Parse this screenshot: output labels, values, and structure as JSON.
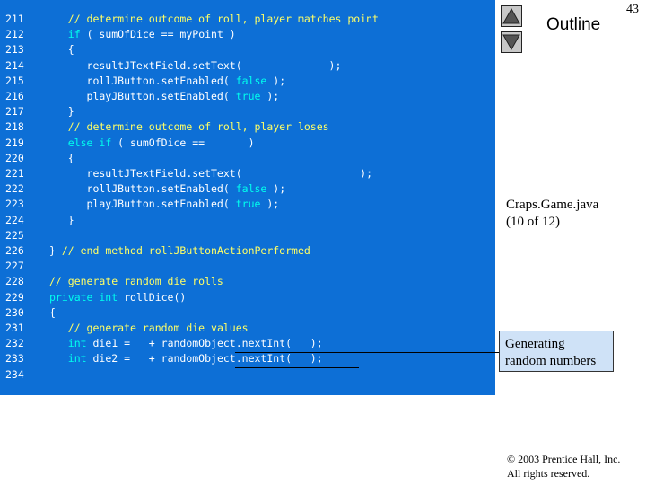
{
  "slide_number": "43",
  "outline_label": "Outline",
  "file_caption": [
    "Craps.Game.java",
    "(10 of 12)"
  ],
  "callout_lines": [
    "Generating",
    "random numbers"
  ],
  "copyright_lines": [
    "© 2003 Prentice Hall, Inc.",
    "All rights reserved."
  ],
  "code_lines": [
    {
      "n": "211",
      "segs": [
        {
          "t": "   ",
          "c": "tx"
        },
        {
          "t": "// determine outcome of roll, player matches point",
          "c": "cm"
        }
      ]
    },
    {
      "n": "212",
      "segs": [
        {
          "t": "   ",
          "c": "tx"
        },
        {
          "t": "if",
          "c": "kw"
        },
        {
          "t": " ( sumOfDice == myPoint )",
          "c": "tx"
        }
      ]
    },
    {
      "n": "213",
      "segs": [
        {
          "t": "   {",
          "c": "tx"
        }
      ]
    },
    {
      "n": "214",
      "segs": [
        {
          "t": "      resultJTextField.setText(              );",
          "c": "tx"
        }
      ]
    },
    {
      "n": "215",
      "segs": [
        {
          "t": "      rollJButton.setEnabled( ",
          "c": "tx"
        },
        {
          "t": "false",
          "c": "kw"
        },
        {
          "t": " );",
          "c": "tx"
        }
      ]
    },
    {
      "n": "216",
      "segs": [
        {
          "t": "      playJButton.setEnabled( ",
          "c": "tx"
        },
        {
          "t": "true",
          "c": "kw"
        },
        {
          "t": " );",
          "c": "tx"
        }
      ]
    },
    {
      "n": "217",
      "segs": [
        {
          "t": "   }",
          "c": "tx"
        }
      ]
    },
    {
      "n": "218",
      "segs": [
        {
          "t": "   ",
          "c": "tx"
        },
        {
          "t": "// determine outcome of roll, player loses",
          "c": "cm"
        }
      ]
    },
    {
      "n": "219",
      "segs": [
        {
          "t": "   ",
          "c": "tx"
        },
        {
          "t": "else if",
          "c": "kw"
        },
        {
          "t": " ( sumOfDice ==       )",
          "c": "tx"
        }
      ]
    },
    {
      "n": "220",
      "segs": [
        {
          "t": "   {",
          "c": "tx"
        }
      ]
    },
    {
      "n": "221",
      "segs": [
        {
          "t": "      resultJTextField.setText(                   );",
          "c": "tx"
        }
      ]
    },
    {
      "n": "222",
      "segs": [
        {
          "t": "      rollJButton.setEnabled( ",
          "c": "tx"
        },
        {
          "t": "false",
          "c": "kw"
        },
        {
          "t": " );",
          "c": "tx"
        }
      ]
    },
    {
      "n": "223",
      "segs": [
        {
          "t": "      playJButton.setEnabled( ",
          "c": "tx"
        },
        {
          "t": "true",
          "c": "kw"
        },
        {
          "t": " );",
          "c": "tx"
        }
      ]
    },
    {
      "n": "224",
      "segs": [
        {
          "t": "   }",
          "c": "tx"
        }
      ]
    },
    {
      "n": "225",
      "segs": []
    },
    {
      "n": "226",
      "segs": [
        {
          "t": "} ",
          "c": "tx"
        },
        {
          "t": "// end method rollJButtonActionPerformed",
          "c": "cm"
        }
      ]
    },
    {
      "n": "227",
      "segs": []
    },
    {
      "n": "228",
      "segs": [
        {
          "t": "// generate random die rolls",
          "c": "cm"
        }
      ]
    },
    {
      "n": "229",
      "segs": [
        {
          "t": "private int",
          "c": "kw"
        },
        {
          "t": " rollDice()",
          "c": "tx"
        }
      ]
    },
    {
      "n": "230",
      "segs": [
        {
          "t": "{",
          "c": "tx"
        }
      ]
    },
    {
      "n": "231",
      "segs": [
        {
          "t": "   ",
          "c": "tx"
        },
        {
          "t": "// generate random die values",
          "c": "cm"
        }
      ]
    },
    {
      "n": "232",
      "segs": [
        {
          "t": "   ",
          "c": "tx"
        },
        {
          "t": "int",
          "c": "kw"
        },
        {
          "t": " die1 =   + randomObject.nextInt(   );",
          "c": "tx"
        }
      ]
    },
    {
      "n": "233",
      "segs": [
        {
          "t": "   ",
          "c": "tx"
        },
        {
          "t": "int",
          "c": "kw"
        },
        {
          "t": " die2 =   + randomObject.nextInt(   );",
          "c": "tx"
        }
      ]
    },
    {
      "n": "234",
      "segs": []
    }
  ]
}
